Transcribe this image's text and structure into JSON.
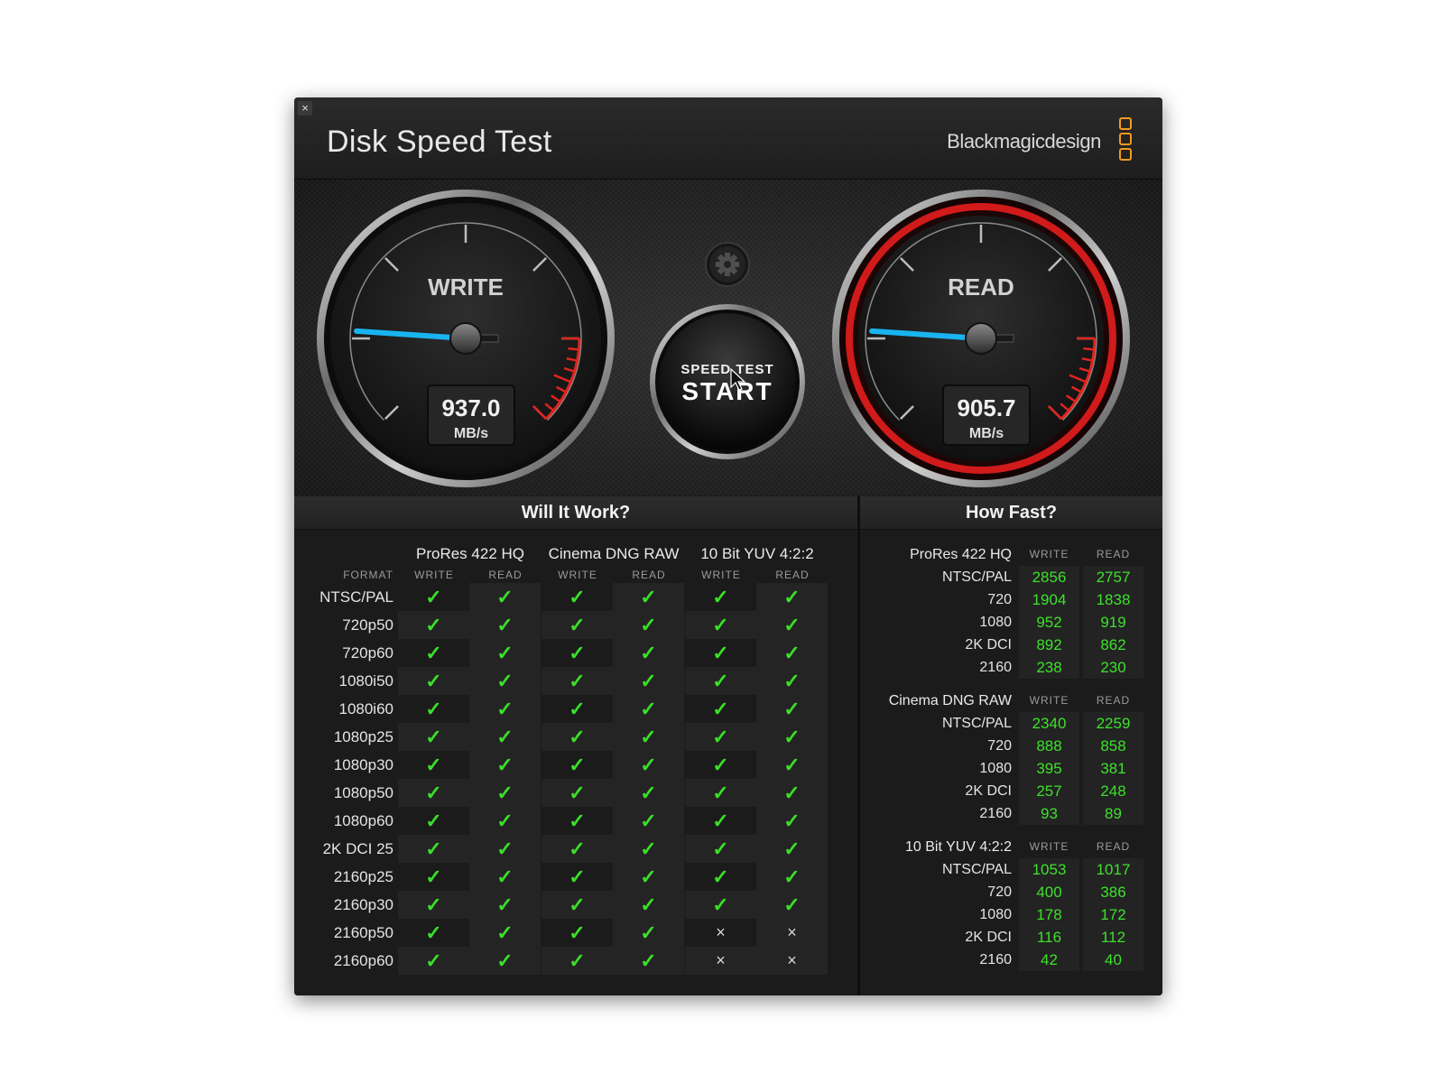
{
  "window": {
    "title": "Disk Speed Test",
    "close_glyph": "×",
    "brand": "Blackmagicdesign"
  },
  "gauges": {
    "write": {
      "label": "WRITE",
      "value": "937.0",
      "unit": "MB/s",
      "needle_fraction": 0.02
    },
    "read": {
      "label": "READ",
      "value": "905.7",
      "unit": "MB/s",
      "needle_fraction": 0.02
    }
  },
  "start_button": {
    "line1": "SPEED TEST",
    "line2": "START"
  },
  "settings_icon": "gear-icon",
  "colors": {
    "accent_blue": "#19b4f0",
    "read_ring": "#d11a1a",
    "ok_green": "#3adf2a",
    "brand_orange": "#f29a1e"
  },
  "will_it_work": {
    "title": "Will It Work?",
    "format_label": "FORMAT",
    "groups": [
      "ProRes 422 HQ",
      "Cinema DNG RAW",
      "10 Bit YUV 4:2:2"
    ],
    "sub_labels": [
      "WRITE",
      "READ",
      "WRITE",
      "READ",
      "WRITE",
      "READ"
    ],
    "rows": [
      {
        "format": "NTSC/PAL",
        "cells": [
          "✓",
          "✓",
          "✓",
          "✓",
          "✓",
          "✓"
        ]
      },
      {
        "format": "720p50",
        "cells": [
          "✓",
          "✓",
          "✓",
          "✓",
          "✓",
          "✓"
        ]
      },
      {
        "format": "720p60",
        "cells": [
          "✓",
          "✓",
          "✓",
          "✓",
          "✓",
          "✓"
        ]
      },
      {
        "format": "1080i50",
        "cells": [
          "✓",
          "✓",
          "✓",
          "✓",
          "✓",
          "✓"
        ]
      },
      {
        "format": "1080i60",
        "cells": [
          "✓",
          "✓",
          "✓",
          "✓",
          "✓",
          "✓"
        ]
      },
      {
        "format": "1080p25",
        "cells": [
          "✓",
          "✓",
          "✓",
          "✓",
          "✓",
          "✓"
        ]
      },
      {
        "format": "1080p30",
        "cells": [
          "✓",
          "✓",
          "✓",
          "✓",
          "✓",
          "✓"
        ]
      },
      {
        "format": "1080p50",
        "cells": [
          "✓",
          "✓",
          "✓",
          "✓",
          "✓",
          "✓"
        ]
      },
      {
        "format": "1080p60",
        "cells": [
          "✓",
          "✓",
          "✓",
          "✓",
          "✓",
          "✓"
        ]
      },
      {
        "format": "2K DCI 25",
        "cells": [
          "✓",
          "✓",
          "✓",
          "✓",
          "✓",
          "✓"
        ]
      },
      {
        "format": "2160p25",
        "cells": [
          "✓",
          "✓",
          "✓",
          "✓",
          "✓",
          "✓"
        ]
      },
      {
        "format": "2160p30",
        "cells": [
          "✓",
          "✓",
          "✓",
          "✓",
          "✓",
          "✓"
        ]
      },
      {
        "format": "2160p50",
        "cells": [
          "✓",
          "✓",
          "✓",
          "✓",
          "×",
          "×"
        ]
      },
      {
        "format": "2160p60",
        "cells": [
          "✓",
          "✓",
          "✓",
          "✓",
          "×",
          "×"
        ]
      }
    ]
  },
  "how_fast": {
    "title": "How Fast?",
    "col_labels": [
      "WRITE",
      "READ"
    ],
    "groups": [
      {
        "name": "ProRes 422 HQ",
        "rows": [
          {
            "format": "NTSC/PAL",
            "write": "2856",
            "read": "2757"
          },
          {
            "format": "720",
            "write": "1904",
            "read": "1838"
          },
          {
            "format": "1080",
            "write": "952",
            "read": "919"
          },
          {
            "format": "2K DCI",
            "write": "892",
            "read": "862"
          },
          {
            "format": "2160",
            "write": "238",
            "read": "230"
          }
        ]
      },
      {
        "name": "Cinema DNG RAW",
        "rows": [
          {
            "format": "NTSC/PAL",
            "write": "2340",
            "read": "2259"
          },
          {
            "format": "720",
            "write": "888",
            "read": "858"
          },
          {
            "format": "1080",
            "write": "395",
            "read": "381"
          },
          {
            "format": "2K DCI",
            "write": "257",
            "read": "248"
          },
          {
            "format": "2160",
            "write": "93",
            "read": "89"
          }
        ]
      },
      {
        "name": "10 Bit YUV 4:2:2",
        "rows": [
          {
            "format": "NTSC/PAL",
            "write": "1053",
            "read": "1017"
          },
          {
            "format": "720",
            "write": "400",
            "read": "386"
          },
          {
            "format": "1080",
            "write": "178",
            "read": "172"
          },
          {
            "format": "2K DCI",
            "write": "116",
            "read": "112"
          },
          {
            "format": "2160",
            "write": "42",
            "read": "40"
          }
        ]
      }
    ]
  }
}
